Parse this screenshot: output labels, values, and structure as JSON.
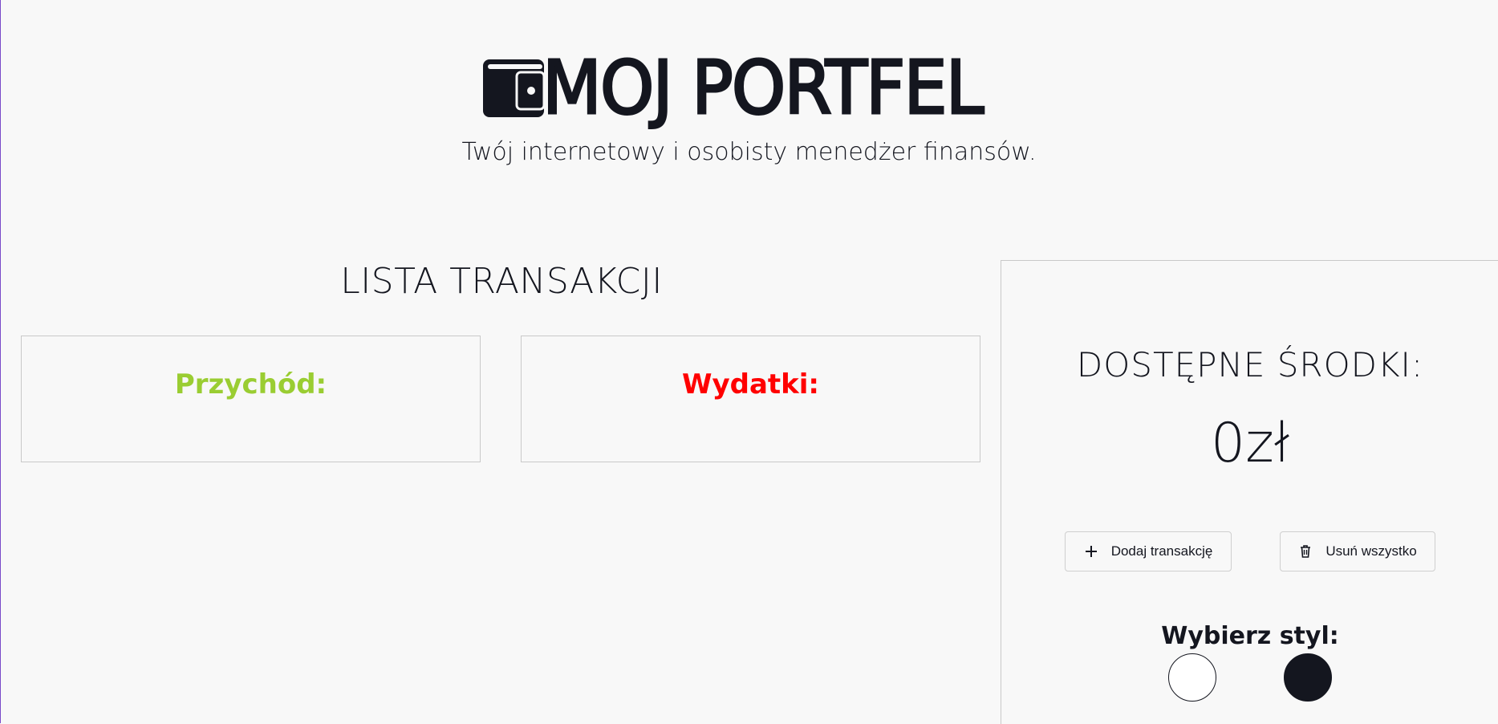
{
  "header": {
    "logo_text": "MOJ PORTFEL",
    "logo_icon": "wallet-icon",
    "tagline": "Twój internetowy i osobisty menedżer finansów."
  },
  "transactions": {
    "title": "LISTA TRANSAKCJI",
    "income_label": "Przychód:",
    "expense_label": "Wydatki:",
    "income_color": "#9acd32",
    "expense_color": "#ff0000"
  },
  "balance": {
    "title": "DOSTĘPNE ŚRODKI:",
    "amount": "0zł"
  },
  "actions": {
    "add_label": "Dodaj transakcję",
    "add_icon": "plus-icon",
    "clear_label": "Usuń wszystko",
    "clear_icon": "trash-icon"
  },
  "style_picker": {
    "label": "Wybierz styl:",
    "options": [
      {
        "name": "light",
        "color": "#ffffff"
      },
      {
        "name": "dark",
        "color": "#14161f"
      }
    ]
  },
  "colors": {
    "text": "#14161f",
    "background": "#f8f8f8",
    "border": "#c9c9c9"
  }
}
